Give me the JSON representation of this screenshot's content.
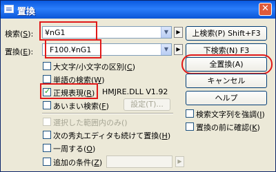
{
  "window": {
    "title": "置換",
    "close_glyph": "✕"
  },
  "search": {
    "label_pre": "検索(",
    "key": "S",
    "label_post": "):",
    "value": "¥nG1"
  },
  "replace": {
    "label_pre": "置換(",
    "key": "E",
    "label_post": "):",
    "value": "F100.¥nG1"
  },
  "checkboxes": [
    {
      "text": "大文字/小文字の区別(",
      "key": "C",
      "post": ")",
      "checked": false,
      "disabled": false
    },
    {
      "text": "単語の検索(",
      "key": "W",
      "post": ")",
      "checked": false,
      "disabled": false
    },
    {
      "text": "正規表現(",
      "key": "R",
      "post": ")",
      "checked": true,
      "disabled": false
    },
    {
      "text": "あいまい検索(",
      "key": "F",
      "post": ")",
      "checked": false,
      "disabled": false
    },
    {
      "text": "選択した範囲内のみ(",
      "key": "",
      "post": ")",
      "checked": false,
      "disabled": true
    },
    {
      "text": "次の秀丸エディタも続けて置換(",
      "key": "H",
      "post": ")",
      "checked": false,
      "disabled": false
    },
    {
      "text": "一周する(",
      "key": "O",
      "post": ")",
      "checked": false,
      "disabled": false
    },
    {
      "text": "追加の条件(",
      "key": "Z",
      "post": ")",
      "checked": false,
      "disabled": false
    }
  ],
  "dll_version": "HMJRE.DLL V1.92",
  "settings_button": "設定(T)...",
  "buttons": {
    "search_up": "上検索(P) Shift+F3",
    "search_down": "下検索(N) F3",
    "replace_all": "全置換(A)",
    "cancel": "キャンセル",
    "help": "ヘルプ"
  },
  "right_checkboxes": [
    {
      "text": "検索文字列を強調(",
      "key": "I",
      "post": ")"
    },
    {
      "text": "置換の前に確認(",
      "key": "K",
      "post": ")"
    }
  ],
  "glyphs": {
    "dropdown": "▼",
    "arrow": "▶"
  },
  "colors": {
    "highlight": "#e01818",
    "titlebar": "#0a5ae0"
  }
}
